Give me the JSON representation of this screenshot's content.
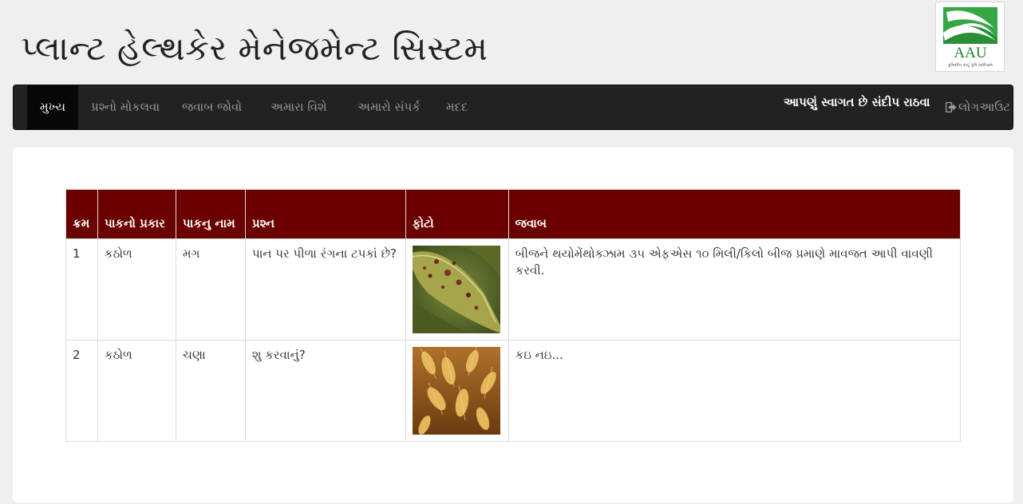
{
  "header": {
    "title": "પ્લાન્ટ હેલ્થકેર મેનેજમેન્ટ સિસ્ટમ",
    "logo_text": "AAU",
    "logo_tagline": "કૃષિવર્ધન રાષ્ટ્ર કૃષિ સર્વાધ્યમ"
  },
  "nav": {
    "items": [
      "મુખ્ય",
      "પ્રશ્નો મોકલવા",
      "જવાબ જોવો",
      "અમારા વિશે",
      "અમારો સંપર્ક",
      "મદદ"
    ],
    "active": "મુખ્ય",
    "welcome": "આપણું સ્વાગત છે સંદીપ રાઠવા",
    "logout": "લોગઆઉટ",
    "logout_icon": "logout-icon"
  },
  "table": {
    "headers": {
      "no": "ક્રમ",
      "crop_type": "પાકનો પ્રકાર",
      "crop_name": "પાકનુ નામ",
      "question": "પ્રશ્ન",
      "photo": "ફોટો",
      "answer": "જવાબ"
    },
    "rows": [
      {
        "no": "1",
        "crop_type": "કઠોળ",
        "crop_name": "મગ",
        "question": "પાન પર પીળા રંગના ટપકાં છે?",
        "photo": "spotted-leaf-photo",
        "answer": "બીજને થયોમેંથોક્ઝામ ૩૫ એફએસ ૧૦ મિલી/કિલો બીજ પ્રમાણે માવજત આપી વાવણી કરવી."
      },
      {
        "no": "2",
        "crop_type": "કઠોળ",
        "crop_name": "ચણા",
        "question": "શુ કરવાનું?",
        "photo": "wheat-field-photo",
        "answer": "કઇ નઇ..."
      }
    ]
  },
  "colors": {
    "navbar": "#222222",
    "table_header": "#6b0000",
    "logo_green": "#2e9a3a"
  }
}
